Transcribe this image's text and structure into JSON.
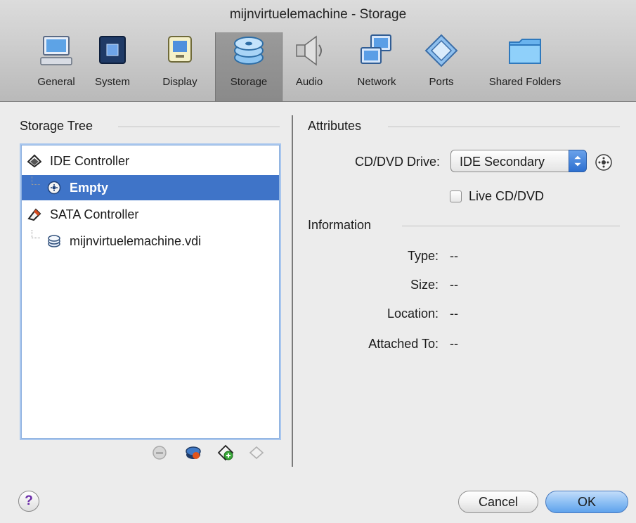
{
  "window": {
    "title": "mijnvirtuelemachine - Storage"
  },
  "toolbar": {
    "items": [
      {
        "label": "General",
        "icon": "monitor-icon"
      },
      {
        "label": "System",
        "icon": "chip-icon"
      },
      {
        "label": "Display",
        "icon": "display-icon"
      },
      {
        "label": "Storage",
        "icon": "disk-stack-icon",
        "selected": true
      },
      {
        "label": "Audio",
        "icon": "speaker-icon"
      },
      {
        "label": "Network",
        "icon": "network-icon"
      },
      {
        "label": "Ports",
        "icon": "ports-icon"
      },
      {
        "label": "Shared Folders",
        "icon": "folder-icon"
      }
    ]
  },
  "storage_tree": {
    "title": "Storage Tree",
    "items": [
      {
        "label": "IDE Controller",
        "icon": "ide-controller-icon",
        "level": 0
      },
      {
        "label": "Empty",
        "icon": "cd-icon",
        "level": 1,
        "selected": true
      },
      {
        "label": "SATA Controller",
        "icon": "sata-controller-icon",
        "level": 0
      },
      {
        "label": "mijnvirtuelemachine.vdi",
        "icon": "hard-disk-icon",
        "level": 1
      }
    ]
  },
  "attributes": {
    "title": "Attributes",
    "cd_dvd_drive_label": "CD/DVD Drive:",
    "cd_dvd_drive_value": "IDE Secondary",
    "live_cd_label": "Live CD/DVD",
    "live_cd_checked": false
  },
  "information": {
    "title": "Information",
    "rows": [
      {
        "label": "Type:",
        "value": "--"
      },
      {
        "label": "Size:",
        "value": "--"
      },
      {
        "label": "Location:",
        "value": "--"
      },
      {
        "label": "Attached To:",
        "value": "--"
      }
    ]
  },
  "buttons": {
    "help": "?",
    "cancel": "Cancel",
    "ok": "OK"
  },
  "colors": {
    "selection": "#3f74c8",
    "primary_button": "#8ec0f4",
    "help_mark": "#6a2aa8"
  }
}
